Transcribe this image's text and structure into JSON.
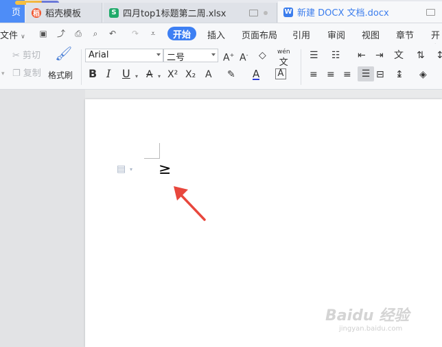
{
  "tabs": {
    "home_label": "页",
    "stroke_label": "稻壳模板",
    "xlsx_label": "四月top1标题第二周.xlsx",
    "docx_label": "新建 DOCX 文档.docx",
    "xlsx_icon_letter": "S",
    "docx_icon_letter": "W"
  },
  "menu": {
    "file": "文件",
    "items": [
      "开始",
      "插入",
      "页面布局",
      "引用",
      "审阅",
      "视图",
      "章节",
      "开发"
    ]
  },
  "ribbon": {
    "cut": "剪切",
    "copy": "复制",
    "format_painter": "格式刷",
    "font_name": "Arial",
    "font_size": "二号",
    "pinyin_glyph": "wén",
    "bold": "B",
    "italic": "I",
    "underline": "U",
    "superscript": "X²",
    "subscript": "X₂"
  },
  "document": {
    "content": "≥"
  },
  "colors": {
    "accent": "#3d7ff3",
    "arrow": "#e8473d",
    "xlsx_icon": "#1faa6a",
    "docx_icon": "#3b7ded",
    "stroke_icon": "#f0542d"
  },
  "watermark": {
    "brand": "Baidu 经验",
    "url": "jingyan.baidu.com"
  }
}
